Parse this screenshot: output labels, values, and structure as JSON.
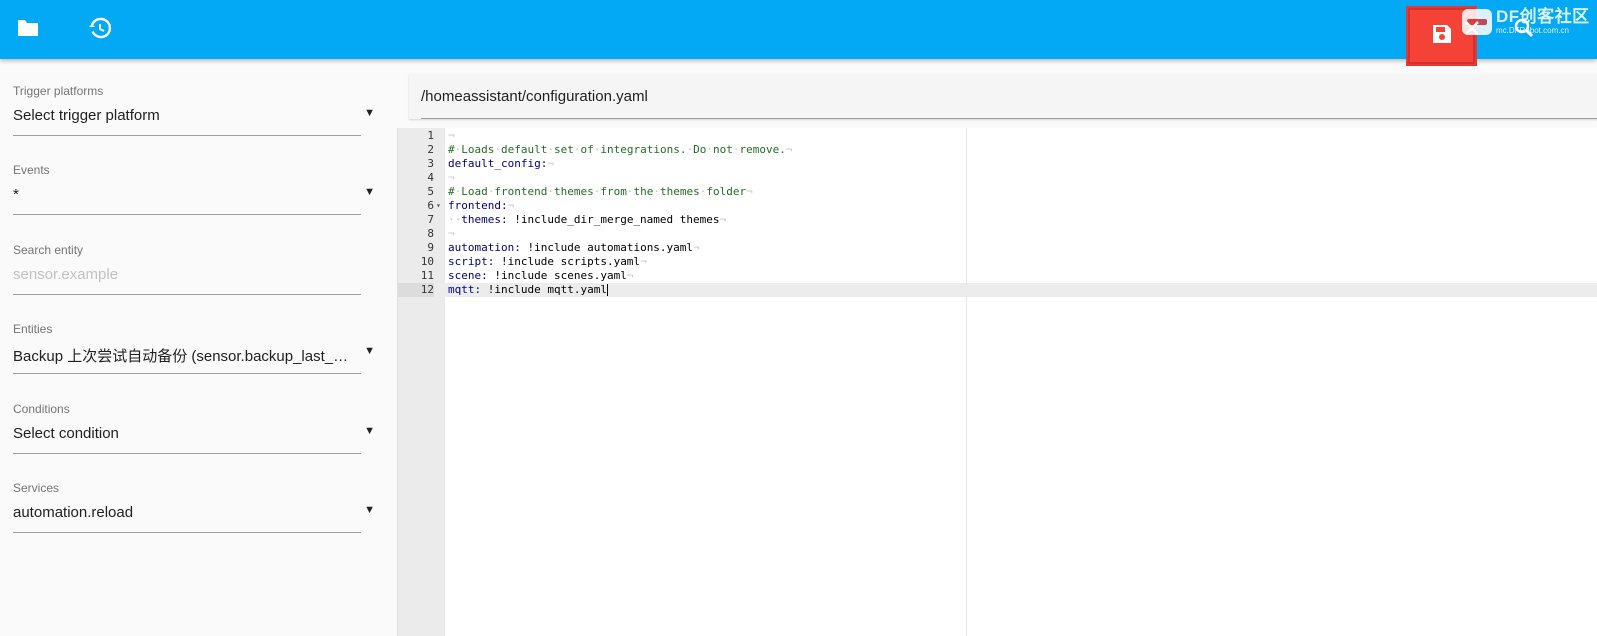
{
  "toolbar": {
    "folder_icon": "folder-icon",
    "history_icon": "history-icon",
    "save_icon": "save-icon",
    "close_icon": "close-icon",
    "search_icon": "search-icon",
    "accent_color": "#03a9f4",
    "save_color": "#f44336",
    "watermark_title": "DF创客社区",
    "watermark_sub": "mc.DFRobot.com.cn"
  },
  "sidebar": {
    "fields": [
      {
        "label": "Trigger platforms",
        "value": "Select trigger platform",
        "placeholder": false
      },
      {
        "label": "Events",
        "value": "*",
        "placeholder": false
      },
      {
        "label": "Search entity",
        "value": "sensor.example",
        "placeholder": true
      },
      {
        "label": "Entities",
        "value": "Backup 上次尝试自动备份 (sensor.backup_last_attempted_automatic_backup)",
        "placeholder": false
      },
      {
        "label": "Conditions",
        "value": "Select condition",
        "placeholder": false
      },
      {
        "label": "Services",
        "value": "automation.reload",
        "placeholder": false
      }
    ],
    "dropdown_arrow": "▼"
  },
  "editor": {
    "file_path": "/homeassistant/configuration.yaml",
    "active_line": 12,
    "lines": [
      {
        "n": "1",
        "text": ""
      },
      {
        "n": "2",
        "text": "# Loads default set of integrations. Do not remove."
      },
      {
        "n": "3",
        "text": "default_config:"
      },
      {
        "n": "4",
        "text": ""
      },
      {
        "n": "5",
        "text": "# Load frontend themes from the themes folder"
      },
      {
        "n": "6",
        "text": "frontend:"
      },
      {
        "n": "7",
        "text": "  themes: !include_dir_merge_named themes"
      },
      {
        "n": "8",
        "text": ""
      },
      {
        "n": "9",
        "text": "automation: !include automations.yaml"
      },
      {
        "n": "10",
        "text": "script: !include scripts.yaml"
      },
      {
        "n": "11",
        "text": "scene: !include scenes.yaml"
      },
      {
        "n": "12",
        "text": "mqtt: !include mqtt.yaml"
      }
    ]
  }
}
